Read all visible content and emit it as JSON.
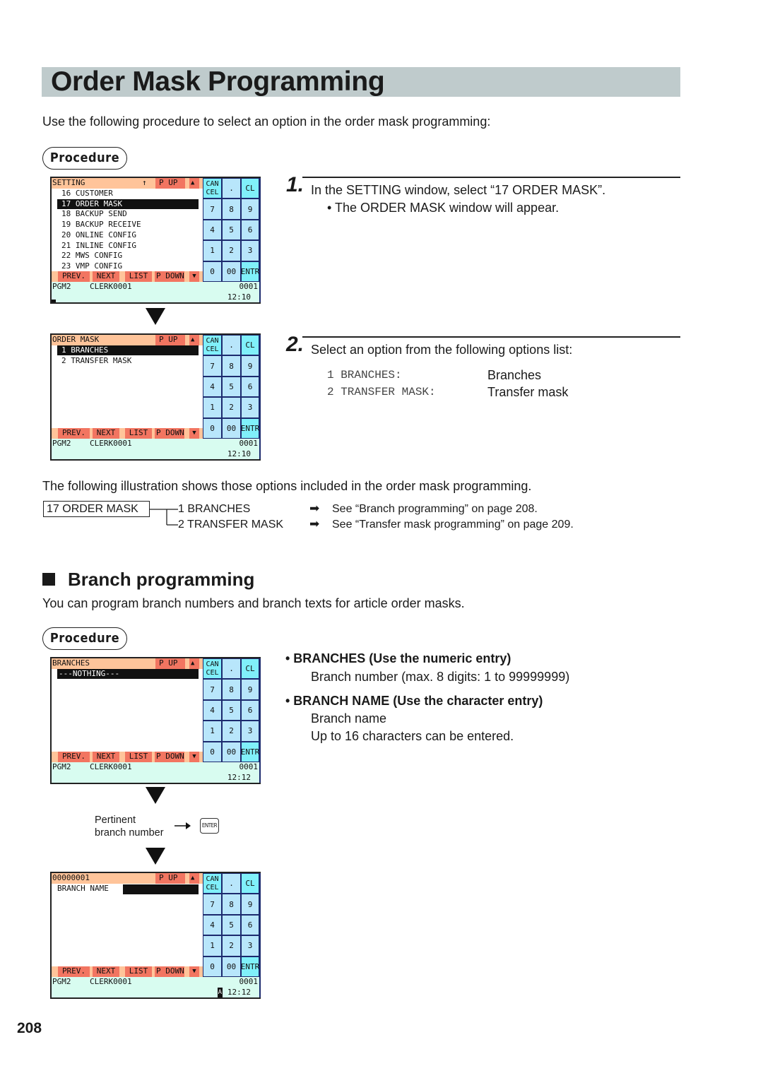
{
  "page": {
    "title": "Order Mask Programming",
    "intro": "Use the following procedure to select an option in the order mask programming:",
    "procedure_label": "Procedure",
    "page_number": "208"
  },
  "screens": [
    {
      "header": "SETTING",
      "header_arrow": "↑",
      "pup": "P UP",
      "rows": [
        "16 CUSTOMER",
        "17 ORDER MASK",
        "18 BACKUP SEND",
        "19 BACKUP RECEIVE",
        "20 ONLINE CONFIG",
        "21 INLINE CONFIG",
        "22 MWS CONFIG",
        "23 VMP CONFIG"
      ],
      "selected_index": 1,
      "status_left": "PGM2    CLERK0001",
      "status_right": "0001",
      "time": "12:10"
    },
    {
      "header": "ORDER MASK",
      "pup": "P UP",
      "rows": [
        "1 BRANCHES",
        "2 TRANSFER MASK"
      ],
      "selected_index": 0,
      "status_left": "PGM2    CLERK0001",
      "status_right": "0001",
      "time": "12:10"
    },
    {
      "header": "BRANCHES",
      "pup": "P UP",
      "rows": [
        "---NOTHING---"
      ],
      "selected_index": 0,
      "status_left": "PGM2    CLERK0001",
      "status_right": "0001",
      "time": "12:12"
    },
    {
      "header": "00000001",
      "pup": "P UP",
      "rows": [
        "BRANCH NAME"
      ],
      "status_left": "PGM2    CLERK0001",
      "status_right": "0001",
      "mode_indicator": "A",
      "time": "12:12"
    }
  ],
  "screen_common": {
    "footer_keys": [
      "PREV.",
      "NEXT",
      "LIST",
      "P DOWN",
      "▼"
    ],
    "up_arrow": "▲",
    "keypad": [
      [
        "CAN\nCEL",
        ".",
        "CL"
      ],
      [
        "7",
        "8",
        "9"
      ],
      [
        "4",
        "5",
        "6"
      ],
      [
        "1",
        "2",
        "3"
      ],
      [
        "0",
        "00",
        "ENTR"
      ]
    ]
  },
  "steps": [
    {
      "number": "1.",
      "text": "In the SETTING window, select “17 ORDER MASK”.",
      "note": "• The ORDER MASK window will appear."
    },
    {
      "number": "2.",
      "text": "Select an option from the following options list:",
      "options": [
        {
          "code": "1 BRANCHES:",
          "desc": "Branches"
        },
        {
          "code": "2 TRANSFER MASK:",
          "desc": "Transfer mask"
        }
      ]
    }
  ],
  "illustration": {
    "intro": "The following illustration shows those options included in the order mask programming.",
    "root": "17 ORDER MASK",
    "children": [
      {
        "label": "1 BRANCHES",
        "ref": "See “Branch programming” on page 208."
      },
      {
        "label": "2 TRANSFER MASK",
        "ref": "See “Transfer mask programming” on page 209."
      }
    ]
  },
  "branch_section": {
    "heading": "Branch programming",
    "intro": "You can program branch numbers and branch texts for article order masks.",
    "items": [
      {
        "title": "• BRANCHES (Use the numeric entry)",
        "lines": [
          "Branch number (max. 8 digits: 1 to 99999999)"
        ]
      },
      {
        "title": "• BRANCH NAME (Use the character entry)",
        "lines": [
          "Branch name",
          "Up to 16 characters can be entered."
        ]
      }
    ],
    "entry_label_1": "Pertinent",
    "entry_label_2": "branch number",
    "enter_key": "ENTER"
  }
}
